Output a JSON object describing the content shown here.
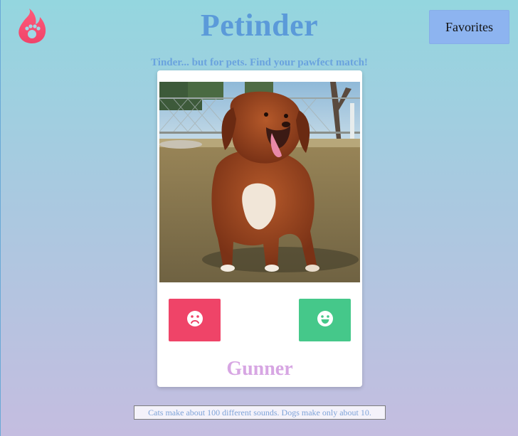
{
  "app": {
    "title": "Petinder",
    "subtitle": "Tinder... but for pets. Find your pawfect match!",
    "favorites_label": "Favorites",
    "logo_icon": "flame-paw-icon"
  },
  "card": {
    "photo_icon": "dog-photo",
    "dislike_icon": "sad-face-icon",
    "like_icon": "happy-face-icon",
    "pet_name": "Gunner"
  },
  "footer": {
    "fact": "Cats make about 100 different sounds. Dogs make only about 10."
  },
  "colors": {
    "title": "#5b9ad9",
    "favorites_bg": "#8db4f0",
    "dislike": "#ef4468",
    "like": "#45c88a",
    "pet_name": "#d7a6e3"
  }
}
